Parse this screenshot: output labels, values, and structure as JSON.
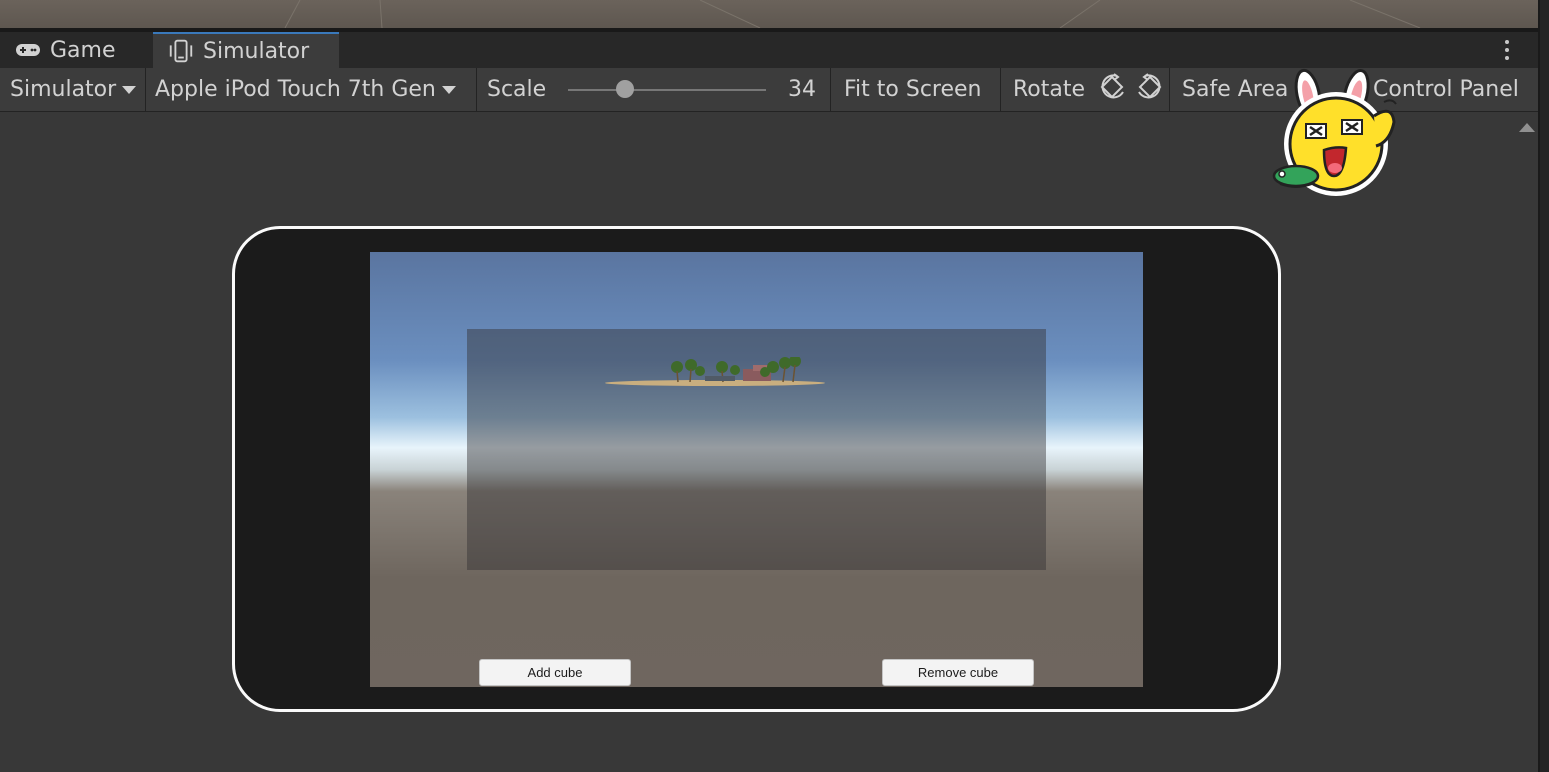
{
  "tabs": [
    {
      "label": "Game",
      "icon": "gamepad-icon"
    },
    {
      "label": "Simulator",
      "icon": "phone-icon",
      "active": true
    }
  ],
  "toolbar": {
    "mode_label": "Simulator",
    "device_label": "Apple iPod Touch 7th Gen",
    "scale_label": "Scale",
    "scale_value": "34",
    "fit_label": "Fit to Screen",
    "rotate_label": "Rotate",
    "safe_area_label": "Safe Area",
    "control_panel_label": "Control Panel"
  },
  "game": {
    "add_button": "Add cube",
    "remove_button": "Remove cube"
  },
  "colors": {
    "accent": "#3a79bb",
    "panel_bg": "#383838",
    "toolbar_bg": "#3c3c3c",
    "tab_bar_bg": "#282828"
  }
}
